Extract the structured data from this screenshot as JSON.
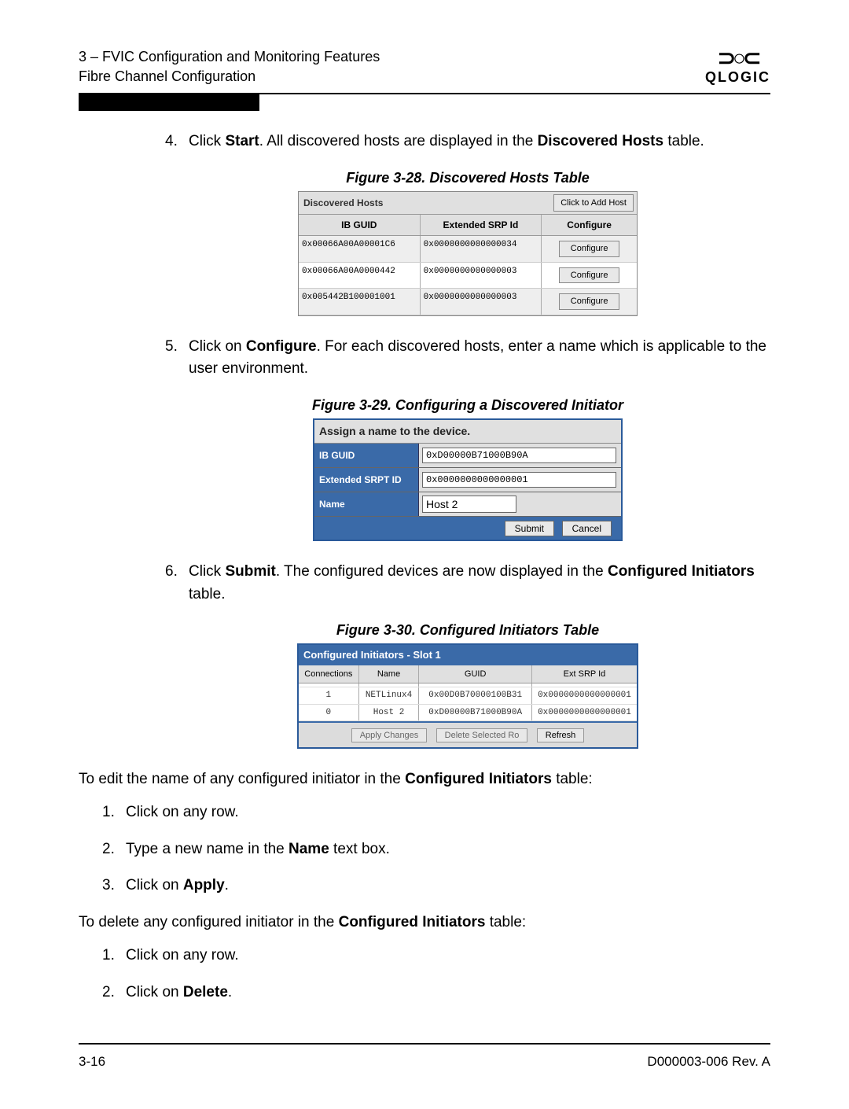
{
  "header": {
    "line1": "3 – FVIC Configuration and Monitoring Features",
    "line2": "Fibre Channel Configuration",
    "logo": "QLOGIC"
  },
  "steps": {
    "s4_num": "4.",
    "s4_a": "Click ",
    "s4_b": "Start",
    "s4_c": ". All discovered hosts are displayed in the ",
    "s4_d": "Discovered Hosts",
    "s4_e": " table.",
    "s5_num": "5.",
    "s5_a": "Click on ",
    "s5_b": "Configure",
    "s5_c": ". For each discovered hosts, enter a name which is applicable to the user environment.",
    "s6_num": "6.",
    "s6_a": "Click ",
    "s6_b": "Submit",
    "s6_c": ". The configured devices are now displayed in the ",
    "s6_d": "Configured Initiators",
    "s6_e": " table."
  },
  "fig28": {
    "caption": "Figure 3-28. Discovered Hosts Table",
    "title": "Discovered Hosts",
    "addhost": "Click to Add Host",
    "h1": "IB GUID",
    "h2": "Extended SRP Id",
    "h3": "Configure",
    "configure_btn": "Configure",
    "rows": [
      {
        "c1": "0x00066A00A00001C6",
        "c2": "0x0000000000000034"
      },
      {
        "c1": "0x00066A00A0000442",
        "c2": "0x0000000000000003"
      },
      {
        "c1": "0x005442B100001001",
        "c2": "0x0000000000000003"
      }
    ]
  },
  "fig29": {
    "caption": "Figure 3-29. Configuring a Discovered Initiator",
    "title": "Assign a name to the device.",
    "l1": "IB GUID",
    "v1": "0xD00000B71000B90A",
    "l2": "Extended SRPT ID",
    "v2": "0x0000000000000001",
    "l3": "Name",
    "v3": "Host 2",
    "submit": "Submit",
    "cancel": "Cancel"
  },
  "fig30": {
    "caption": "Figure 3-30. Configured Initiators Table",
    "title": "Configured Initiators - Slot 1",
    "h1": "Connections",
    "h2": "Name",
    "h3": "GUID",
    "h4": "Ext SRP Id",
    "rows": [
      {
        "c1": "",
        "c2": "",
        "c3": "",
        "c4": ""
      },
      {
        "c1": "1",
        "c2": "NETLinux4",
        "c3": "0x00D0B70000100B31",
        "c4": "0x0000000000000001"
      },
      {
        "c1": "0",
        "c2": "Host 2",
        "c3": "0xD00000B71000B90A",
        "c4": "0x0000000000000001"
      }
    ],
    "b1": "Apply Changes",
    "b2": "Delete Selected Ro",
    "b3": "Refresh"
  },
  "body": {
    "edit_intro_a": "To edit the name of any configured initiator in the ",
    "edit_intro_b": "Configured Initiators",
    "edit_intro_c": " table:",
    "e1n": "1.",
    "e1": "Click on any row.",
    "e2n": "2.",
    "e2a": "Type a new name in the ",
    "e2b": "Name",
    "e2c": " text box.",
    "e3n": "3.",
    "e3a": "Click on ",
    "e3b": "Apply",
    "e3c": ".",
    "del_intro_a": "To delete any configured initiator in the ",
    "del_intro_b": "Configured Initiators",
    "del_intro_c": " table:",
    "d1n": "1.",
    "d1": "Click on any row.",
    "d2n": "2.",
    "d2a": "Click on ",
    "d2b": "Delete",
    "d2c": "."
  },
  "footer": {
    "left": "3-16",
    "right": "D000003-006 Rev. A"
  }
}
